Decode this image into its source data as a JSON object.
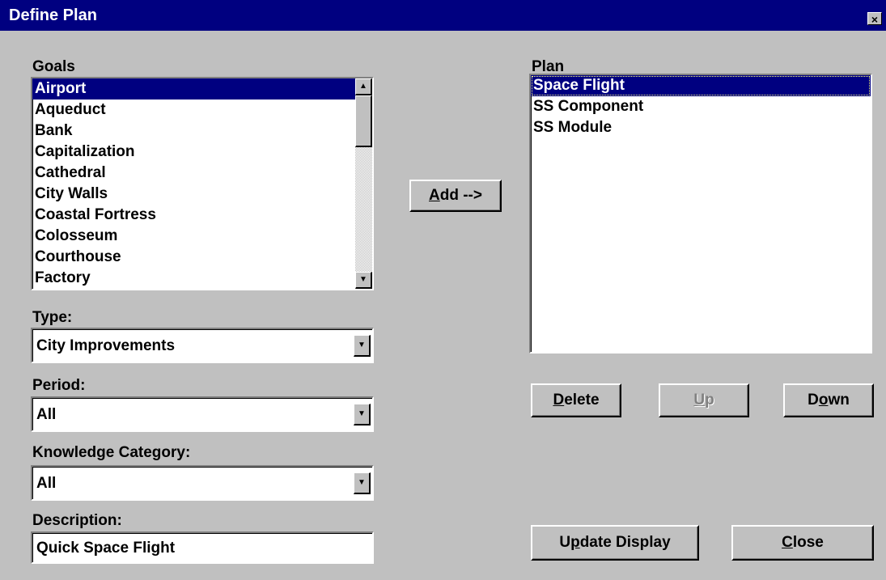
{
  "window": {
    "title": "Define Plan",
    "close_glyph": "×"
  },
  "goals": {
    "label": "Goals",
    "items": [
      "Airport",
      "Aqueduct",
      "Bank",
      "Capitalization",
      "Cathedral",
      "City Walls",
      "Coastal Fortress",
      "Colosseum",
      "Courthouse",
      "Factory"
    ],
    "selected": "Airport"
  },
  "plan": {
    "label": "Plan",
    "items": [
      "Space Flight",
      "SS Component",
      "SS Module"
    ],
    "selected": "Space Flight"
  },
  "type": {
    "label": "Type:",
    "value": "City Improvements"
  },
  "period": {
    "label": "Period:",
    "value": "All"
  },
  "knowledge": {
    "label": "Knowledge Category:",
    "value": "All"
  },
  "description": {
    "label": "Description:",
    "value": "Quick Space Flight"
  },
  "buttons": {
    "add": {
      "mnemonic": "A",
      "rest": "dd -->"
    },
    "delete": {
      "mnemonic": "D",
      "rest": "elete"
    },
    "up": {
      "mnemonic": "U",
      "rest": "p",
      "enabled": false
    },
    "down": {
      "pre": "D",
      "mnemonic": "o",
      "rest": "wn"
    },
    "update": {
      "pre": "U",
      "mnemonic": "p",
      "rest": "date Display"
    },
    "close": {
      "mnemonic": "C",
      "rest": "lose"
    }
  },
  "colors": {
    "titlebar": "#000080",
    "face": "#c0c0c0",
    "selection": "#000080"
  },
  "icons": {
    "scroll_up": "▲",
    "scroll_down": "▼",
    "dropdown": "▼"
  }
}
